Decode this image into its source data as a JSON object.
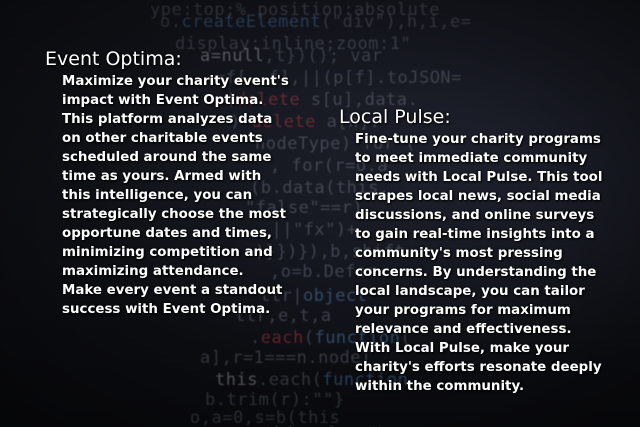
{
  "sections": [
    {
      "title": "Event Optima:",
      "body": "Maximize your charity event's\nimpact with Event Optima.\nThis platform analyzes data\non other charitable events\nscheduled around the same\ntime as yours. Armed with\nthis intelligence, you can\nstrategically choose the most\nopportune dates and times,\nminimizing competition and\nmaximizing attendance.\nMake every event a standout\nsuccess with Event Optima."
    },
    {
      "title": "Local Pulse:",
      "body": "Fine-tune your charity programs\nto meet immediate community\nneeds with Local Pulse. This tool\nscrapes local news, social media\ndiscussions, and online surveys\nto gain real-time insights into a\ncommunity's most pressing\nconcerns. By understanding the\nlocal landscape, you can tailor\nyour programs for maximum\nrelevance and effectiveness.\nWith Local Pulse, make your\ncharity's efforts resonate deeply\nwithin the community."
    }
  ]
}
